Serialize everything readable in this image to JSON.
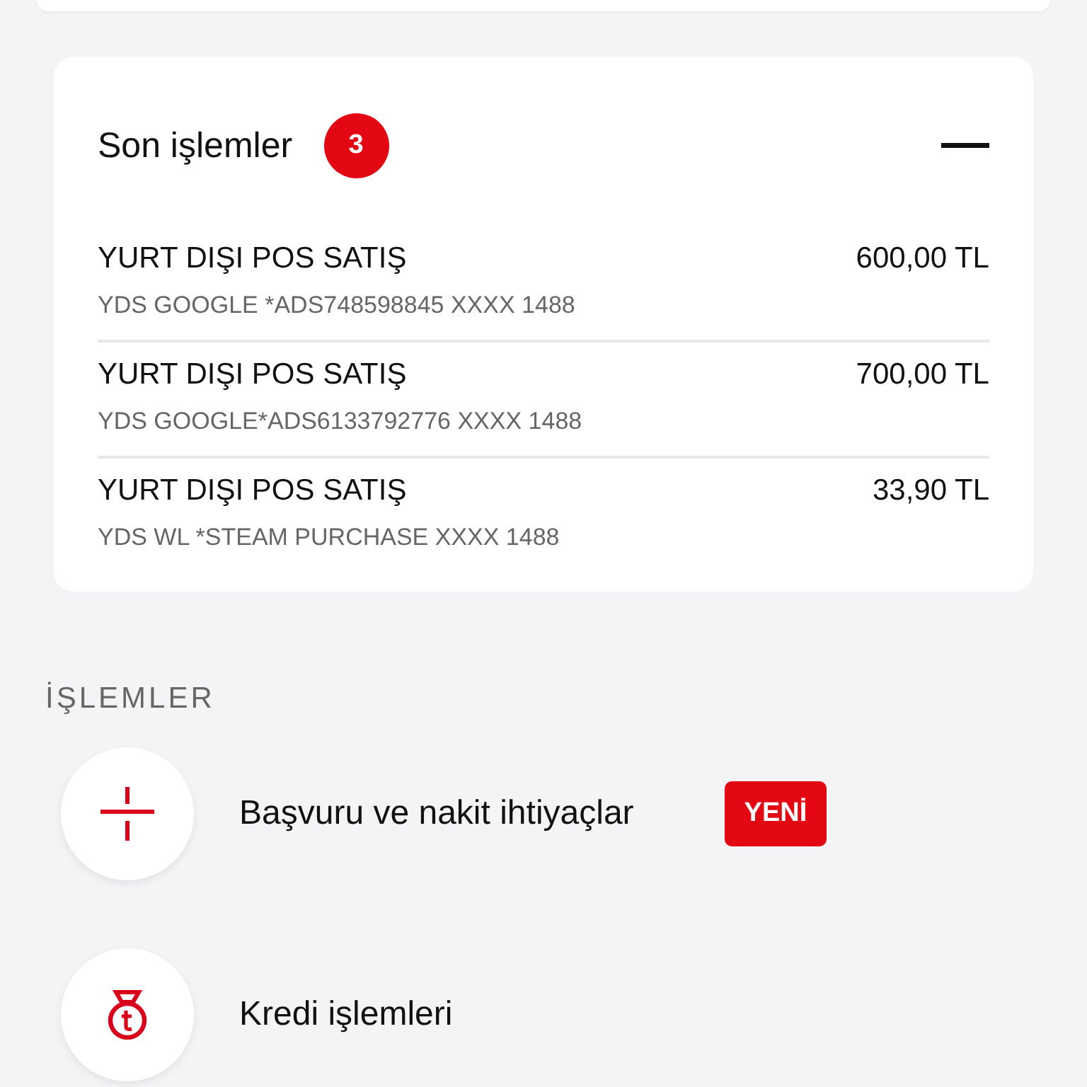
{
  "recent": {
    "title": "Son işlemler",
    "count": "3",
    "expanded": true,
    "transactions": [
      {
        "title": "YURT DIŞI POS SATIŞ",
        "detail": "YDS GOOGLE *ADS748598845 XXXX 1488",
        "amount": "600,00 TL"
      },
      {
        "title": "YURT DIŞI POS SATIŞ",
        "detail": "YDS GOOGLE*ADS6133792776 XXXX 1488",
        "amount": "700,00 TL"
      },
      {
        "title": "YURT DIŞI POS SATIŞ",
        "detail": "YDS WL *STEAM PURCHASE XXXX 1488",
        "amount": "33,90 TL"
      }
    ]
  },
  "operations": {
    "heading": "İŞLEMLER",
    "items": [
      {
        "kind": "plus",
        "label": "Başvuru ve nakit ihtiyaçlar",
        "badge": "YENİ"
      },
      {
        "kind": "moneybag",
        "label": "Kredi işlemleri"
      }
    ]
  }
}
